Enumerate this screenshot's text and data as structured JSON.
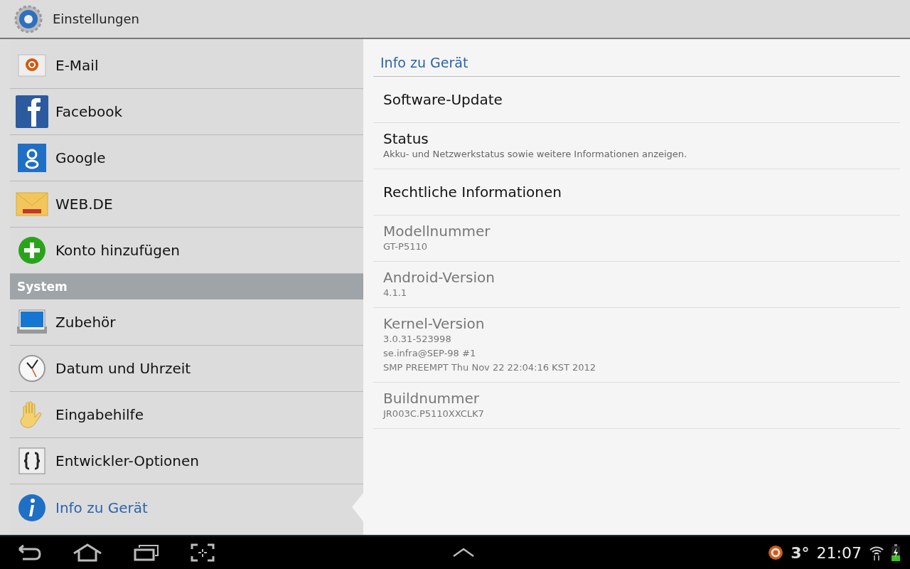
{
  "action_bar": {
    "title": "Einstellungen"
  },
  "accounts": [
    {
      "label": "E-Mail",
      "selected": false
    },
    {
      "label": "Facebook",
      "selected": false
    },
    {
      "label": "Google",
      "selected": false
    },
    {
      "label": "WEB.DE",
      "selected": false
    },
    {
      "label": "Konto hinzufügen",
      "selected": false
    }
  ],
  "system": {
    "header": "System",
    "items": [
      {
        "label": "Zubehör",
        "selected": false
      },
      {
        "label": "Datum und Uhrzeit",
        "selected": false
      },
      {
        "label": "Eingabehilfe",
        "selected": false
      },
      {
        "label": "Entwickler-Optionen",
        "selected": false
      },
      {
        "label": "Info zu Gerät",
        "selected": true
      }
    ]
  },
  "detail": {
    "header": "Info zu Gerät",
    "items": [
      {
        "title": "Software-Update",
        "disabled": false
      },
      {
        "title": "Status",
        "summary": "Akku- und Netzwerkstatus sowie weitere Informationen anzeigen.",
        "disabled": false
      },
      {
        "title": "Rechtliche Informationen",
        "disabled": false
      },
      {
        "title": "Modellnummer",
        "summary": "GT-P5110",
        "disabled": true
      },
      {
        "title": "Android-Version",
        "summary": "4.1.1",
        "disabled": true
      },
      {
        "title": "Kernel-Version",
        "summary": "3.0.31-523998\nse.infra@SEP-98 #1\nSMP PREEMPT Thu Nov 22 22:04:16 KST 2012",
        "disabled": true
      },
      {
        "title": "Buildnummer",
        "summary": "JR003C.P5110XXCLK7",
        "disabled": true
      }
    ]
  },
  "status_bar": {
    "temperature": "3°",
    "time": "21:07"
  }
}
